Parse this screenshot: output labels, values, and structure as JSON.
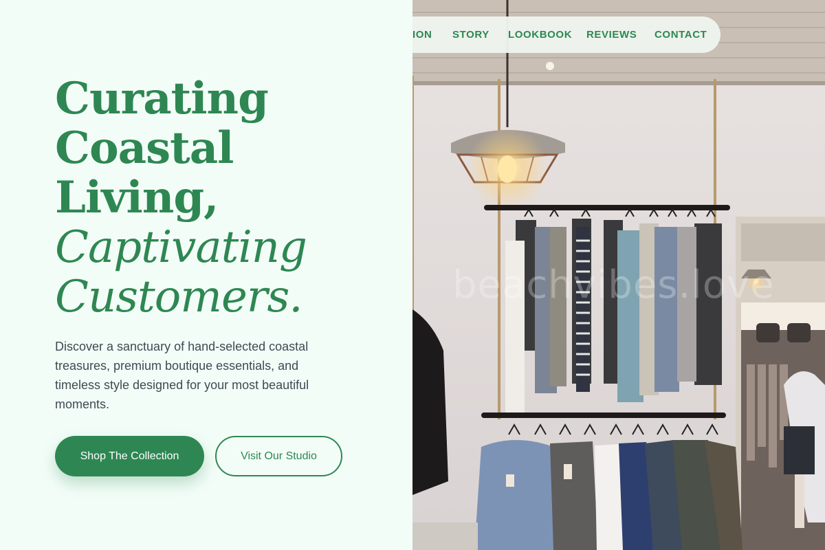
{
  "hero": {
    "headline": [
      "Curating",
      "Coastal",
      "Living,"
    ],
    "headline_italic": [
      "Captivating",
      "Customers."
    ],
    "description": "Discover a sanctuary of hand-selected coastal treasures, premium boutique essentials, and timeless style designed for your most beautiful moments.",
    "primary_button": "Shop The Collection",
    "secondary_button": "Visit Our Studio"
  },
  "nav": {
    "items": [
      "ION",
      "STORY",
      "LOOKBOOK",
      "REVIEWS",
      "CONTACT"
    ]
  },
  "image": {
    "watermark": "beachvibes.love"
  },
  "colors": {
    "accent": "#2e8752",
    "background": "#f3fdf8",
    "text": "#3d4a52"
  }
}
